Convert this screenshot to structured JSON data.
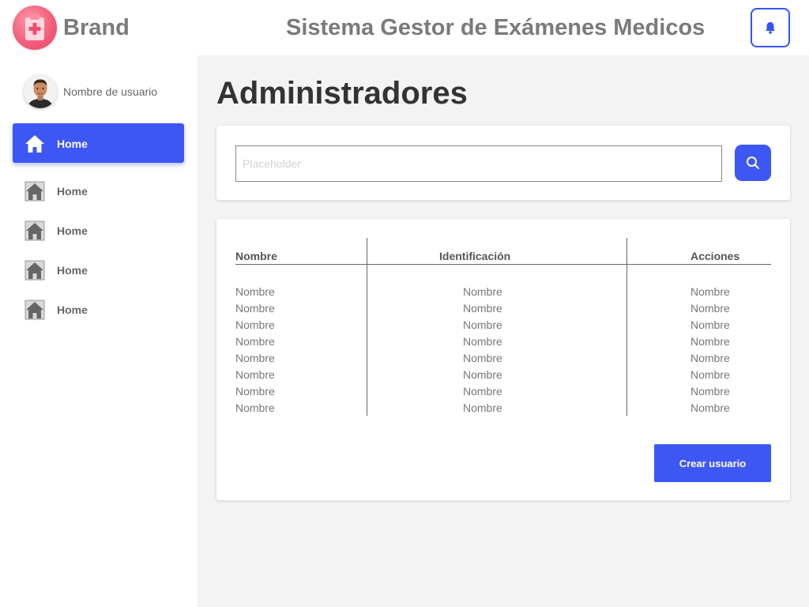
{
  "header": {
    "brand": "Brand",
    "title": "Sistema Gestor de Exámenes Medicos",
    "logo_icon": "medical-clipboard-icon",
    "notification_icon": "bell-icon"
  },
  "sidebar": {
    "username": "Nombre de usuario",
    "items": [
      {
        "label": "Home",
        "icon": "home-icon",
        "active": true
      },
      {
        "label": "Home",
        "icon": "home-icon",
        "active": false
      },
      {
        "label": "Home",
        "icon": "home-icon",
        "active": false
      },
      {
        "label": "Home",
        "icon": "home-icon",
        "active": false
      },
      {
        "label": "Home",
        "icon": "home-icon",
        "active": false
      }
    ]
  },
  "main": {
    "title": "Administradores",
    "search": {
      "placeholder": "Placeholder",
      "value": "",
      "button_icon": "search-icon"
    },
    "table": {
      "headers": [
        "Nombre",
        "Identificación",
        "Acciones"
      ],
      "rows": [
        [
          "Nombre",
          "Nombre",
          "Nombre"
        ],
        [
          "Nombre",
          "Nombre",
          "Nombre"
        ],
        [
          "Nombre",
          "Nombre",
          "Nombre"
        ],
        [
          "Nombre",
          "Nombre",
          "Nombre"
        ],
        [
          "Nombre",
          "Nombre",
          "Nombre"
        ],
        [
          "Nombre",
          "Nombre",
          "Nombre"
        ],
        [
          "Nombre",
          "Nombre",
          "Nombre"
        ],
        [
          "Nombre",
          "Nombre",
          "Nombre"
        ]
      ]
    },
    "create_button": "Crear usuario"
  },
  "colors": {
    "accent": "#3d57f5",
    "logo": "#f25f7a",
    "sidebar_bg": "#ffffff",
    "main_bg": "#f3f3f3"
  }
}
